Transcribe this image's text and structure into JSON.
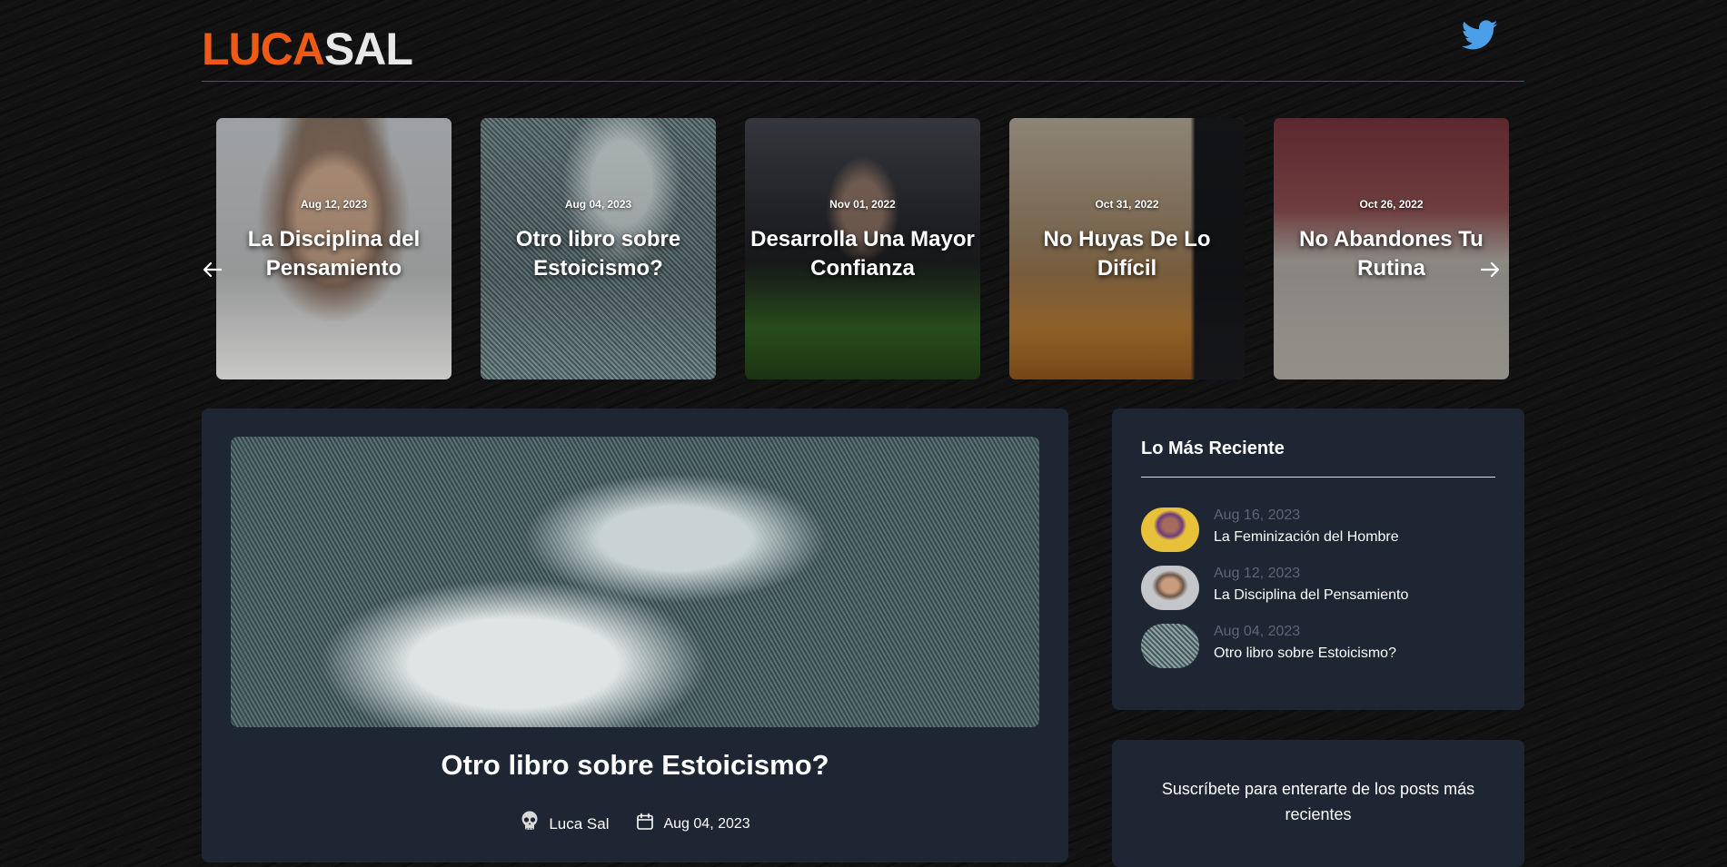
{
  "header": {
    "logo_part1": "LUCA",
    "logo_part2": "SAL",
    "twitter_icon": "twitter-icon",
    "accent_color": "#ee5a16"
  },
  "carousel": {
    "slides": [
      {
        "date": "Aug 12, 2023",
        "title": "La Disciplina del Pensamiento"
      },
      {
        "date": "Aug 04, 2023",
        "title": "Otro libro sobre Estoicismo?"
      },
      {
        "date": "Nov 01, 2022",
        "title": "Desarrolla Una Mayor Confianza"
      },
      {
        "date": "Oct 31, 2022",
        "title": "No Huyas De Lo Difícil"
      },
      {
        "date": "Oct 26, 2022",
        "title": "No Abandones Tu Rutina"
      }
    ]
  },
  "post": {
    "title": "Otro libro sobre Estoicismo?",
    "author": "Luca Sal",
    "date": "Aug 04, 2023"
  },
  "sidebar": {
    "heading": "Lo Más Reciente",
    "items": [
      {
        "date": "Aug 16, 2023",
        "title": "La Feminización del Hombre"
      },
      {
        "date": "Aug 12, 2023",
        "title": "La Disciplina del Pensamiento"
      },
      {
        "date": "Aug 04, 2023",
        "title": "Otro libro sobre Estoicismo?"
      }
    ]
  },
  "subscribe": {
    "text": "Suscríbete para enterarte de los posts más recientes"
  }
}
